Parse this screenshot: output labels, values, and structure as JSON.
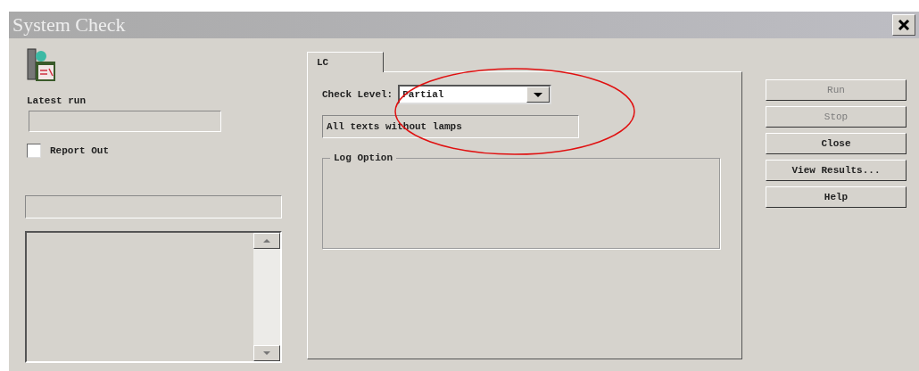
{
  "window": {
    "title": "System Check"
  },
  "left": {
    "latest_run_label": "Latest run",
    "report_out": {
      "label": "Report Out",
      "checked": false
    }
  },
  "tabs": [
    {
      "label": "LC",
      "selected": true
    }
  ],
  "check_level": {
    "label": "Check Level:",
    "value": "Partial"
  },
  "description": "All texts without lamps",
  "log_option": {
    "title": "Log Option"
  },
  "buttons": [
    {
      "label": "Run",
      "disabled": true
    },
    {
      "label": "Stop",
      "disabled": true
    },
    {
      "label": "Close",
      "disabled": false
    },
    {
      "label": "View Results...",
      "disabled": false
    },
    {
      "label": "Help",
      "disabled": false
    }
  ]
}
